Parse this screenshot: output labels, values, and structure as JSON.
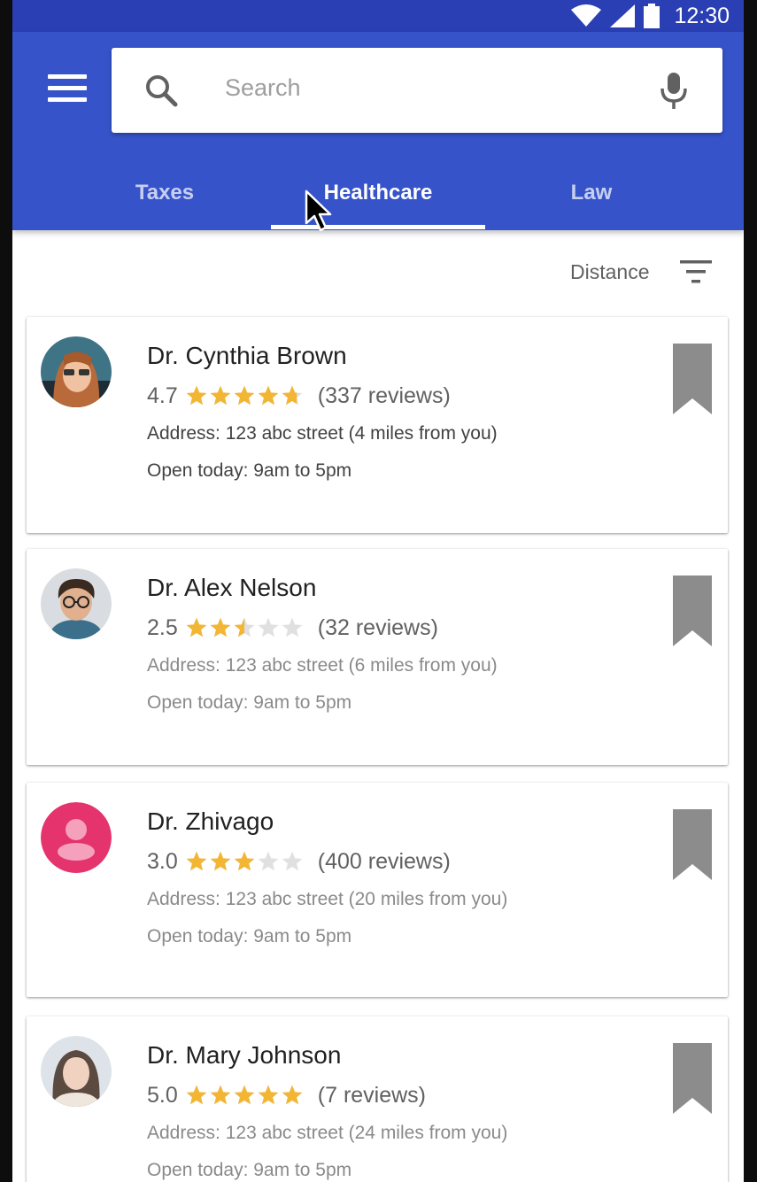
{
  "status_bar": {
    "time": "12:30"
  },
  "search": {
    "placeholder": "Search"
  },
  "tabs": [
    {
      "label": "Taxes",
      "active": false
    },
    {
      "label": "Healthcare",
      "active": true
    },
    {
      "label": "Law",
      "active": false
    }
  ],
  "sort": {
    "label": "Distance"
  },
  "colors": {
    "primary": "#3653c9",
    "primary_dark": "#2a3fb4",
    "star_filled": "#f2b634",
    "star_empty": "#e0e0e0",
    "bookmark": "#8c8c8c",
    "avatar_placeholder": "#e5336d"
  },
  "doctors": [
    {
      "name": "Dr. Cynthia Brown",
      "rating": "4.7",
      "stars": 4.7,
      "reviews": "(337 reviews)",
      "address": "Address: 123 abc street (4 miles from you)",
      "hours": "Open today: 9am to 5pm",
      "avatar_icon": "woman-redhead-photo-avatar"
    },
    {
      "name": "Dr. Alex Nelson",
      "rating": "2.5",
      "stars": 2.5,
      "reviews": "(32 reviews)",
      "address": "Address: 123 abc street (6 miles from you)",
      "hours": "Open today: 9am to 5pm",
      "avatar_icon": "man-glasses-photo-avatar"
    },
    {
      "name": "Dr. Zhivago",
      "rating": "3.0",
      "stars": 3.0,
      "reviews": "(400 reviews)",
      "address": "Address: 123 abc street (20 miles from you)",
      "hours": "Open today: 9am to 5pm",
      "avatar_icon": "default-person-avatar"
    },
    {
      "name": "Dr. Mary Johnson",
      "rating": "5.0",
      "stars": 5.0,
      "reviews": "(7 reviews)",
      "address": "Address: 123 abc street (24 miles from you)",
      "hours": "Open today: 9am to 5pm",
      "avatar_icon": "woman-photo-avatar"
    }
  ]
}
